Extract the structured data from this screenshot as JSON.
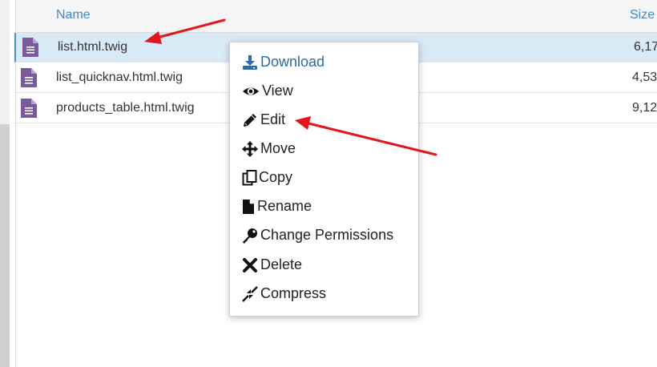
{
  "header": {
    "name_label": "Name",
    "size_label": "Size"
  },
  "files": [
    {
      "name": "list.html.twig",
      "size": "6,17",
      "selected": true
    },
    {
      "name": "list_quicknav.html.twig",
      "size": "4,53",
      "selected": false
    },
    {
      "name": "products_table.html.twig",
      "size": "9,12",
      "selected": false
    }
  ],
  "context_menu": {
    "items": [
      {
        "label": "Download",
        "icon": "download-icon"
      },
      {
        "label": "View",
        "icon": "eye-icon"
      },
      {
        "label": "Edit",
        "icon": "pencil-icon"
      },
      {
        "label": "Move",
        "icon": "move-arrows-icon"
      },
      {
        "label": "Copy",
        "icon": "copy-icon"
      },
      {
        "label": "Rename",
        "icon": "file-icon"
      },
      {
        "label": "Change Permissions",
        "icon": "key-icon"
      },
      {
        "label": "Delete",
        "icon": "x-icon"
      },
      {
        "label": "Compress",
        "icon": "compress-icon"
      }
    ]
  },
  "colors": {
    "file_icon": "#7a5a9a",
    "accent": "#3f89c9",
    "selected_row": "#d9eaf7",
    "annotation_arrow": "#e3161b"
  }
}
